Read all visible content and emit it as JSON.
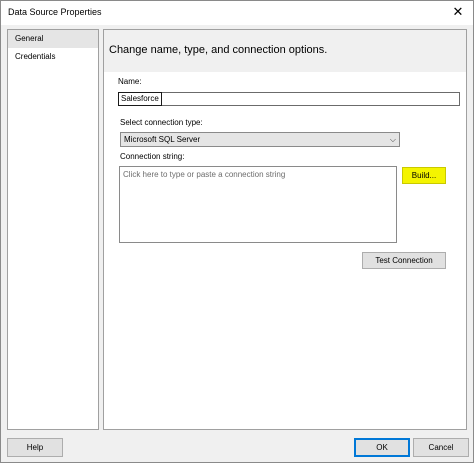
{
  "window": {
    "title": "Data Source Properties",
    "close_glyph": "✕"
  },
  "sidebar": {
    "items": [
      {
        "label": "General",
        "selected": true
      },
      {
        "label": "Credentials",
        "selected": false
      }
    ]
  },
  "main": {
    "header": "Change name, type, and connection options.",
    "name_label": "Name:",
    "name_value": "Salesforce",
    "connection_type_label": "Select connection type:",
    "connection_type_value": "Microsoft SQL Server",
    "connection_string_label": "Connection string:",
    "connection_string_placeholder": "Click here to type or paste a connection string",
    "build_label": "Build...",
    "test_connection_label": "Test Connection"
  },
  "footer": {
    "help_label": "Help",
    "ok_label": "OK",
    "cancel_label": "Cancel"
  },
  "colors": {
    "build_highlight": "#f4f400",
    "default_button_border": "#0078d7"
  },
  "icons": {
    "close": "close-icon",
    "dropdown": "chevron-down-icon"
  }
}
